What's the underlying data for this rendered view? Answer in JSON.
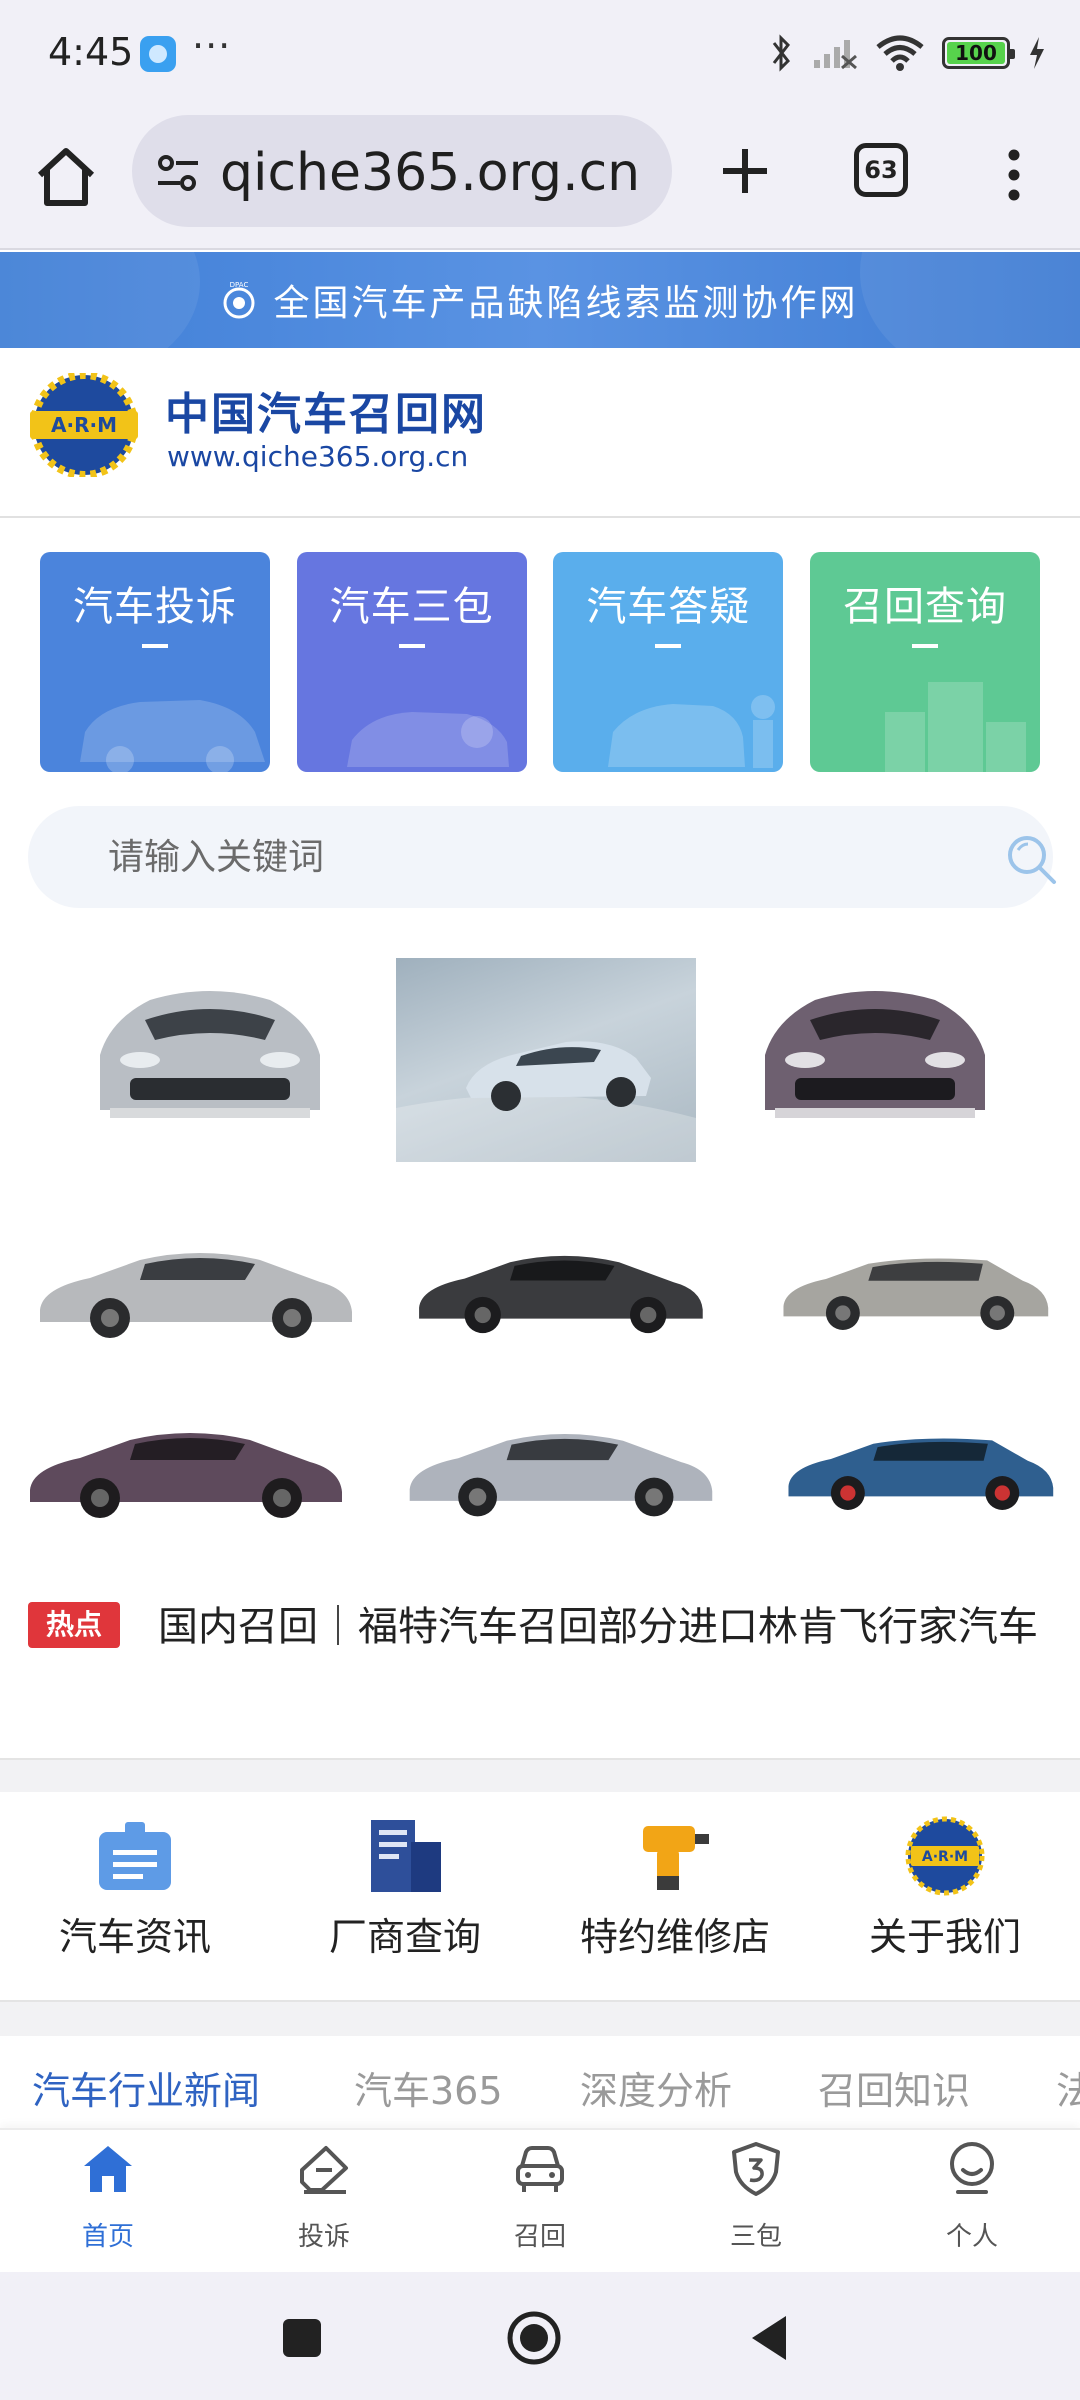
{
  "status_bar": {
    "time": "4:45",
    "more": "···",
    "battery": "100"
  },
  "browser": {
    "url": "qiche365.org.cn",
    "tab_count": "63"
  },
  "banner": {
    "logo_text": "DPAC",
    "text": "全国汽车产品缺陷线索监测协作网"
  },
  "site": {
    "logo_text": "A·R·M",
    "title": "中国汽车召回网",
    "url": "www.qiche365.org.cn"
  },
  "quick_cards": [
    {
      "label": "汽车投诉",
      "color": "#4b84dc"
    },
    {
      "label": "汽车三包",
      "color": "#6676e0"
    },
    {
      "label": "汽车答疑",
      "color": "#5aaeec"
    },
    {
      "label": "召回查询",
      "color": "#5ec994"
    }
  ],
  "search": {
    "placeholder": "请输入关键词"
  },
  "car_colors": [
    "#b9bec4",
    "#c2cdd6",
    "#6e6070",
    "#b7b9bc",
    "#3a3b3e",
    "#a6a5a0",
    "#5e4a5c",
    "#aeb3bc",
    "#2f5f8f"
  ],
  "hot_news": {
    "badge": "热点",
    "text": "国内召回｜福特汽车召回部分进口林肯飞行家汽车"
  },
  "services": [
    {
      "label": "汽车资讯",
      "icon": "news-icon"
    },
    {
      "label": "厂商查询",
      "icon": "building-icon"
    },
    {
      "label": "特约维修店",
      "icon": "drill-icon"
    },
    {
      "label": "关于我们",
      "icon": "arm-logo-icon"
    }
  ],
  "news_tabs": [
    "汽车行业新闻",
    "汽车365",
    "深度分析",
    "召回知识",
    "法"
  ],
  "bottom_nav": [
    {
      "label": "首页",
      "icon": "home-icon",
      "active": true
    },
    {
      "label": "投诉",
      "icon": "complaint-icon",
      "active": false
    },
    {
      "label": "召回",
      "icon": "car-icon",
      "active": false
    },
    {
      "label": "三包",
      "icon": "shield-3-icon",
      "active": false
    },
    {
      "label": "个人",
      "icon": "user-icon",
      "active": false
    }
  ],
  "colors": {
    "accent": "#2f6fd6",
    "brand_navy": "#1a47a3",
    "hot_red": "#e0363b"
  }
}
